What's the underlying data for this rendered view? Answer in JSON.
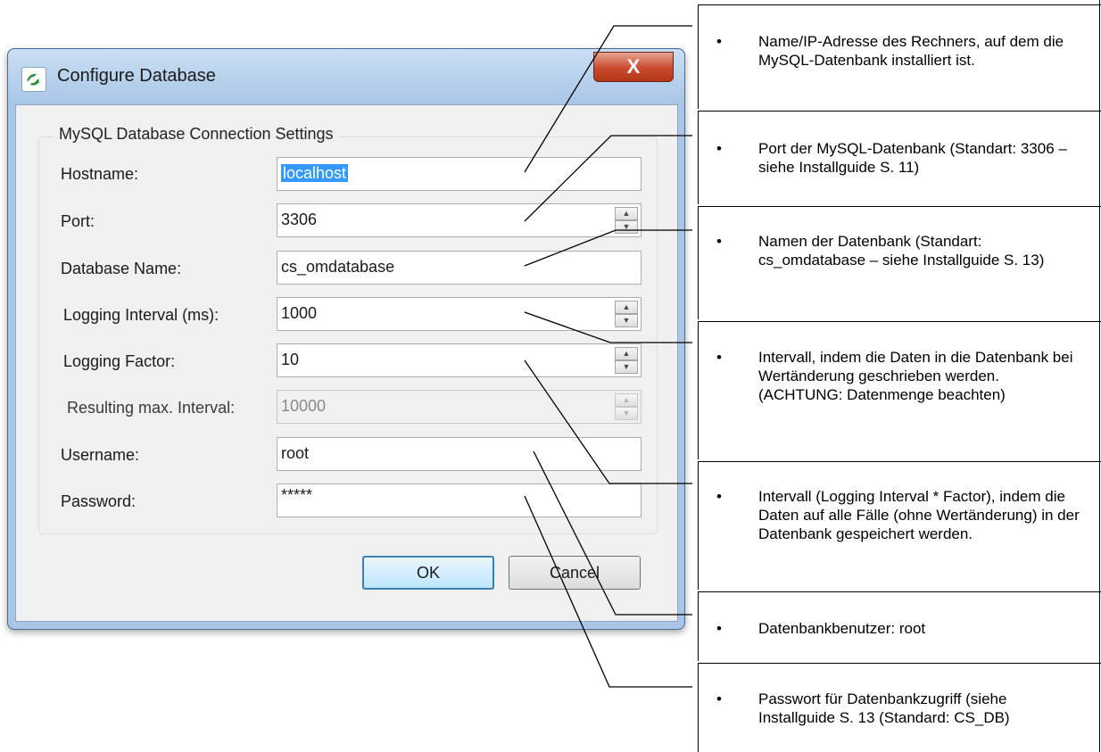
{
  "dialog": {
    "title": "Configure Database",
    "close_label": "X",
    "group_title": "MySQL Database Connection Settings",
    "fields": {
      "hostname": {
        "label": "Hostname:",
        "value": "localhost"
      },
      "port": {
        "label": "Port:",
        "value": "3306"
      },
      "database_name": {
        "label": "Database Name:",
        "value": "cs_omdatabase"
      },
      "logging_interval": {
        "label": "Logging Interval (ms):",
        "value": "1000"
      },
      "logging_factor": {
        "label": "Logging Factor:",
        "value": "10"
      },
      "resulting_interval": {
        "label": "Resulting max. Interval:",
        "value": "10000"
      },
      "username": {
        "label": "Username:",
        "value": "root"
      },
      "password": {
        "label": "Password:",
        "value": "*****"
      }
    },
    "ok_label": "OK",
    "cancel_label": "Cancel"
  },
  "notes": [
    {
      "bullet": "•",
      "text": "Name/IP-Adresse des Rechners, auf dem die MySQL-Datenbank installiert ist."
    },
    {
      "bullet": "•",
      "text": "Port der MySQL-Datenbank (Standart: 3306 – siehe Installguide S. 11)"
    },
    {
      "bullet": "•",
      "text": "Namen der Datenbank (Standart: cs_omdatabase – siehe Installguide S. 13)"
    },
    {
      "bullet": "•",
      "text": "Intervall, indem die Daten in die Datenbank bei Wertänderung geschrieben werden. (ACHTUNG: Datenmenge beachten)"
    },
    {
      "bullet": "•",
      "text": "Intervall (Logging Interval * Factor), indem die Daten auf alle Fälle (ohne Wertänderung) in der Datenbank gespeichert werden."
    },
    {
      "bullet": "•",
      "text": "Datenbankbenutzer: root"
    },
    {
      "bullet": "•",
      "text": "Passwort für Datenbankzugriff (siehe Installguide S. 13 (Standard: CS_DB)"
    }
  ]
}
